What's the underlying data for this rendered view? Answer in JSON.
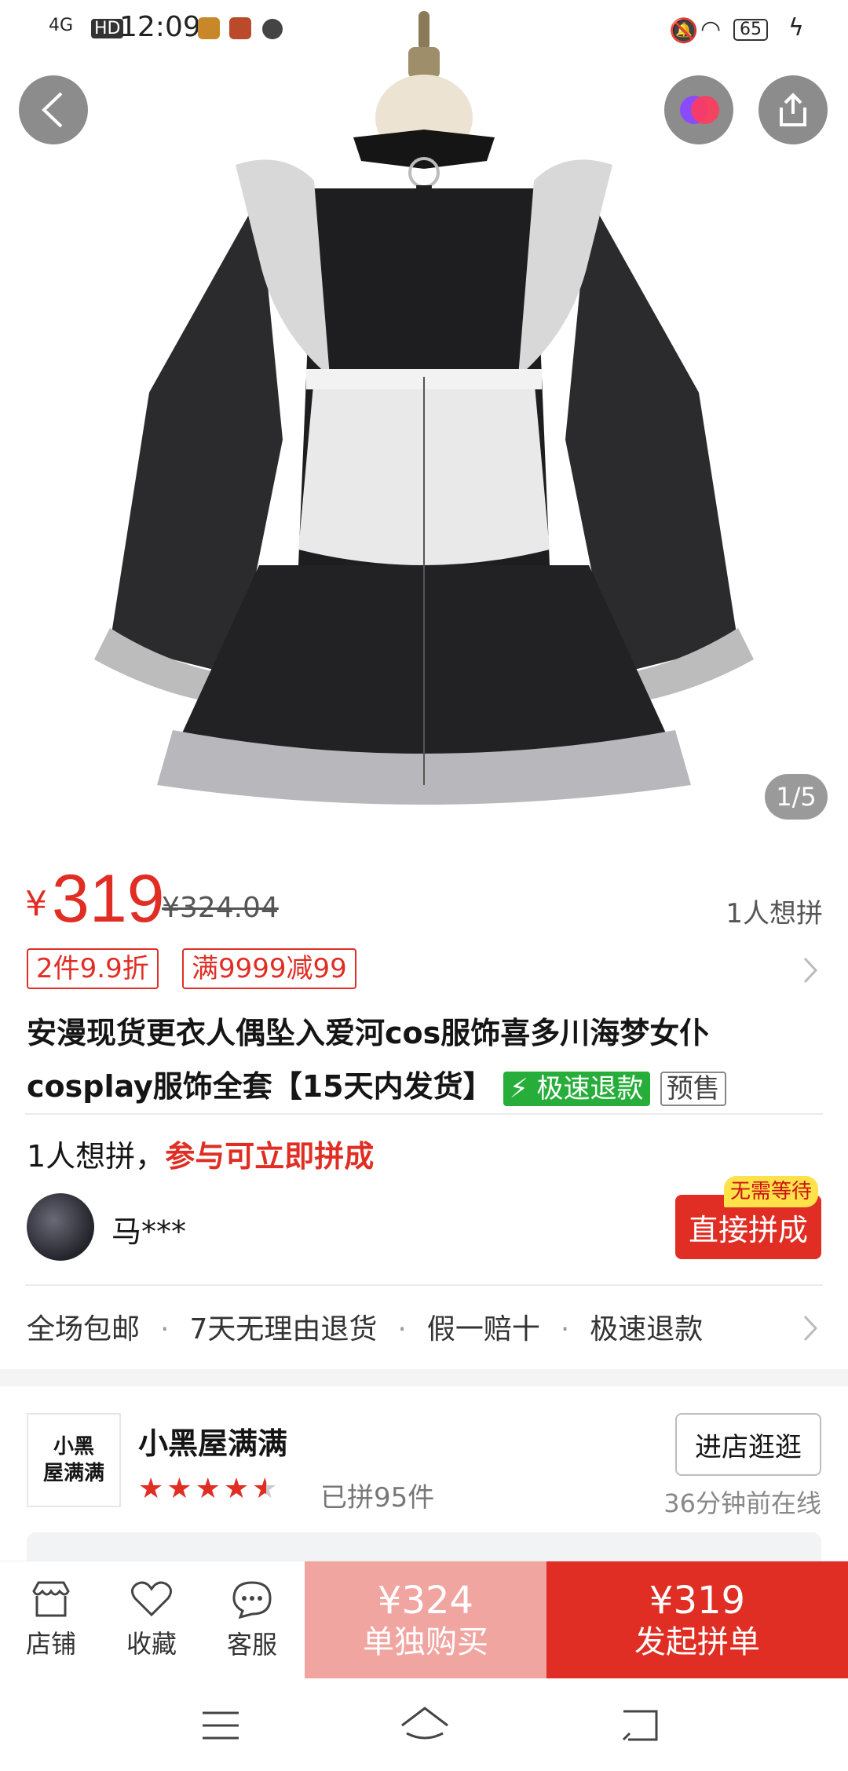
{
  "status_bar": {
    "network": "4G",
    "hd": "HD",
    "time": "12:09",
    "battery": "65"
  },
  "hero": {
    "pager": "1/5"
  },
  "price": {
    "currency": "¥",
    "current": "319",
    "original": "¥324.04",
    "want_count": "1人想拼"
  },
  "promo_tags": [
    "2件9.9折",
    "满9999减99"
  ],
  "product": {
    "title": "安漫现货更衣人偶坠入爱河cos服饰喜多川海梦女仆cosplay服饰全套【15天内发货】",
    "badge_refund": "极速退款",
    "badge_presale": "预售"
  },
  "group": {
    "prefix": "1人想拼，",
    "cta": "参与可立即拼成",
    "user_name": "马***",
    "no_wait": "无需等待",
    "join_label": "直接拼成"
  },
  "services": [
    "全场包邮",
    "7天无理由退货",
    "假一赔十",
    "极速退款"
  ],
  "shop": {
    "logo_line1": "小黑",
    "logo_line2": "屋满满",
    "name": "小黑屋满满",
    "rating": 4.5,
    "sold": "已拼95件",
    "visit_label": "进店逛逛",
    "online": "36分钟前在线"
  },
  "bottom_bar": {
    "store_label": "店铺",
    "fav_label": "收藏",
    "service_label": "客服",
    "alone_price": "¥324",
    "alone_label": "单独购买",
    "group_price": "¥319",
    "group_label": "发起拼单"
  },
  "colors": {
    "accent": "#e02e24",
    "light_accent": "#f1a5a1",
    "refund_green": "#27ae3a"
  }
}
